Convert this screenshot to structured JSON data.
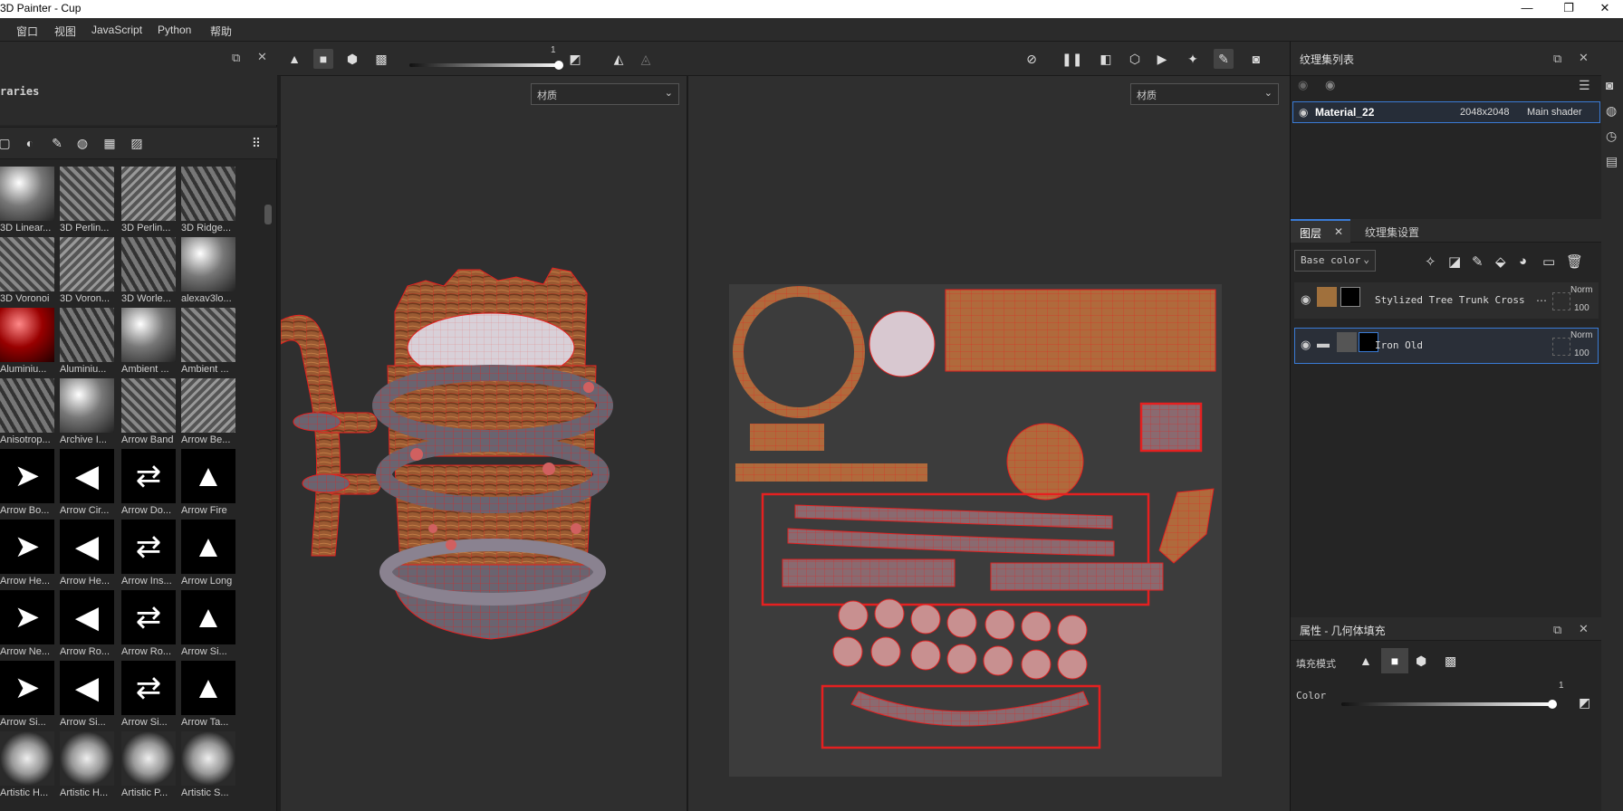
{
  "app": {
    "title": "3D Painter - Cup"
  },
  "window_controls": {
    "minimize": "—",
    "maximize": "❐",
    "close": "✕"
  },
  "menu": {
    "items": [
      "窗口",
      "视图",
      "JavaScript",
      "Python",
      "帮助"
    ]
  },
  "shelf": {
    "title": "raries",
    "assets": [
      {
        "label": "3D Linear..."
      },
      {
        "label": "3D Perlin..."
      },
      {
        "label": "3D Perlin..."
      },
      {
        "label": "3D Ridge..."
      },
      {
        "label": "3D Voronoi"
      },
      {
        "label": "3D Voron..."
      },
      {
        "label": "3D Worle..."
      },
      {
        "label": "alexav3lo..."
      },
      {
        "label": "Aluminiu..."
      },
      {
        "label": "Aluminiu..."
      },
      {
        "label": "Ambient ..."
      },
      {
        "label": "Ambient ..."
      },
      {
        "label": "Anisotrop..."
      },
      {
        "label": "Archive I..."
      },
      {
        "label": "Arrow Band"
      },
      {
        "label": "Arrow Be..."
      },
      {
        "label": "Arrow Bo..."
      },
      {
        "label": "Arrow Cir..."
      },
      {
        "label": "Arrow Do..."
      },
      {
        "label": "Arrow Fire"
      },
      {
        "label": "Arrow He..."
      },
      {
        "label": "Arrow He..."
      },
      {
        "label": "Arrow Ins..."
      },
      {
        "label": "Arrow Long"
      },
      {
        "label": "Arrow Ne..."
      },
      {
        "label": "Arrow Ro..."
      },
      {
        "label": "Arrow Ro..."
      },
      {
        "label": "Arrow Si..."
      },
      {
        "label": "Arrow Si..."
      },
      {
        "label": "Arrow Si..."
      },
      {
        "label": "Arrow Si..."
      },
      {
        "label": "Arrow Ta..."
      },
      {
        "label": "Artistic H..."
      },
      {
        "label": "Artistic H..."
      },
      {
        "label": "Artistic P..."
      },
      {
        "label": "Artistic S..."
      }
    ]
  },
  "toolbar": {
    "slider_value": "1"
  },
  "viewport3d": {
    "dropdown": "材质"
  },
  "viewport2d": {
    "dropdown": "材质"
  },
  "texture_sets": {
    "title": "纹理集列表",
    "row": {
      "name": "Material_22",
      "resolution": "2048x2048",
      "shader": "Main shader"
    }
  },
  "layers": {
    "tabs": [
      "图层",
      "纹理集设置"
    ],
    "channel": "Base color",
    "items": [
      {
        "name": "Stylized Tree Trunk Cross",
        "blend": "Norm",
        "opacity": "100"
      },
      {
        "name": "Iron Old",
        "blend": "Norm",
        "opacity": "100"
      }
    ]
  },
  "properties": {
    "title": "属性 - 几何体填充",
    "fill_mode_label": "填充模式",
    "color_label": "Color",
    "color_value": "1"
  }
}
